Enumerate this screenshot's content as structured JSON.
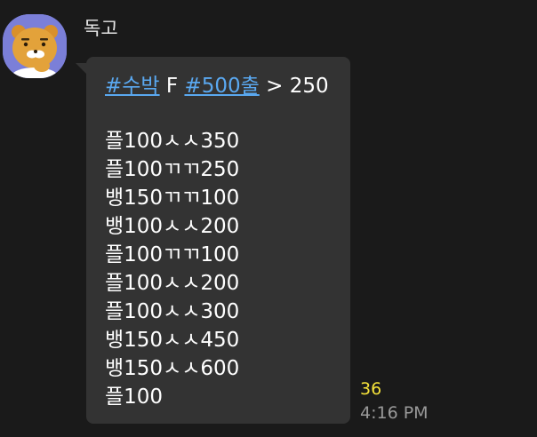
{
  "sender": {
    "name": "독고",
    "avatar_icon": "ryan-character-icon"
  },
  "message": {
    "header": {
      "tag1": "#수박",
      "text1": " F ",
      "tag2": "#500출",
      "text2": " > 250"
    },
    "lines": [
      "플100ㅅㅅ350",
      "플100ㄲㄲ250",
      "뱅150ㄲㄲ100",
      "뱅100ㅅㅅ200",
      "플100ㄲㄲ100",
      "플100ㅅㅅ200",
      "플100ㅅㅅ300",
      "뱅150ㅅㅅ450",
      "뱅150ㅅㅅ600",
      "플100"
    ]
  },
  "meta": {
    "unread_count": "36",
    "time": "4:16 PM"
  },
  "colors": {
    "background": "#1a1a1a",
    "bubble": "#333333",
    "hashtag": "#5aa8f0",
    "unread": "#f5e23a",
    "time": "#9a9a9a"
  }
}
